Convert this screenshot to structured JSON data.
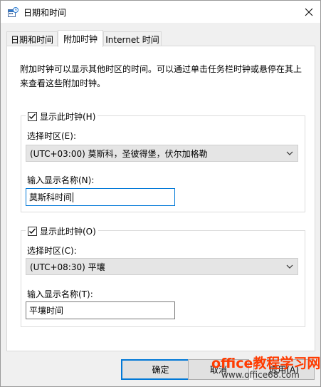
{
  "window": {
    "title": "日期和时间"
  },
  "tabs": [
    {
      "label": "日期和时间"
    },
    {
      "label": "附加时钟"
    },
    {
      "label": "Internet 时间"
    }
  ],
  "description": "附加时钟可以显示其他时区的时间。可以通过单击任务栏时钟或悬停在其上来查看这些附加时钟。",
  "clock1": {
    "show_label": "显示此时钟(H)",
    "checked": true,
    "timezone_label": "选择时区(E):",
    "timezone_value": "(UTC+03:00) 莫斯科，圣彼得堡，伏尔加格勒",
    "name_label": "输入显示名称(N):",
    "name_value": "莫斯科时间"
  },
  "clock2": {
    "show_label": "显示此时钟(O)",
    "checked": true,
    "timezone_label": "选择时区(C):",
    "timezone_value": "(UTC+08:30) 平壤",
    "name_label": "输入显示名称(T):",
    "name_value": "平壤时间"
  },
  "buttons": {
    "ok": "确定",
    "cancel": "取消",
    "apply": "应用(A)"
  },
  "watermark": {
    "line1": "office教程学习网",
    "line2": "www.office68.com"
  },
  "colors": {
    "accent": "#0078d7",
    "watermark": "#ff3b00"
  }
}
